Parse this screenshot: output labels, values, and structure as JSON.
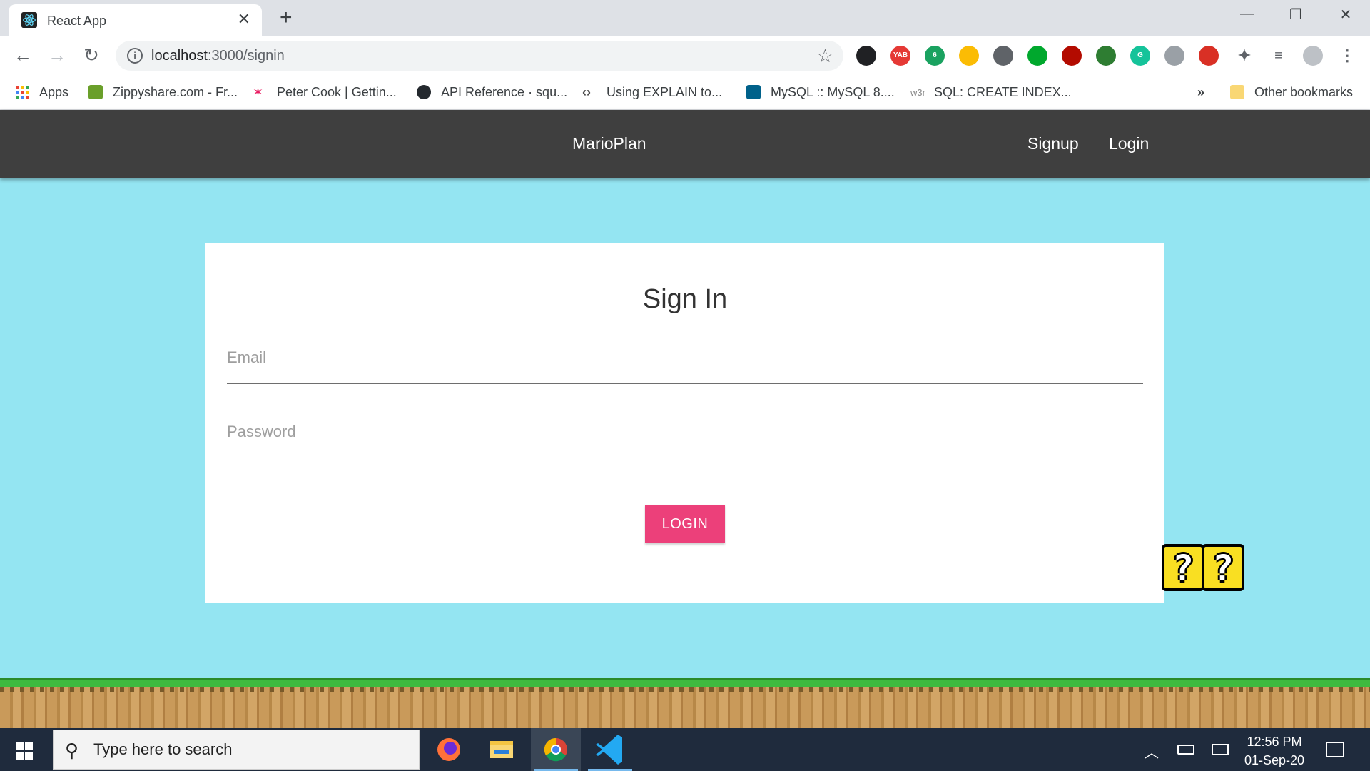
{
  "browser": {
    "tab_title": "React App",
    "tab_close": "✕",
    "new_tab": "+",
    "window_controls": {
      "minimize": "—",
      "restore": "❐",
      "close": "✕"
    },
    "nav": {
      "back": "←",
      "forward": "→",
      "reload": "↻"
    },
    "url_host": "localhost",
    "url_path": ":3000/signin",
    "info_icon": "i",
    "star_icon": "☆",
    "extensions": [
      {
        "name": "Tab Manager",
        "color": "#202124",
        "text": ""
      },
      {
        "name": "YAB",
        "color": "#e53935",
        "text": "YAB"
      },
      {
        "name": "Badge Extension",
        "color": "#1aa260",
        "text": "6"
      },
      {
        "name": "Heart",
        "color": "#fbbc04",
        "text": ""
      },
      {
        "name": "Pocket",
        "color": "#5f6368",
        "text": ""
      },
      {
        "name": "Evernote",
        "color": "#00a82d",
        "text": ""
      },
      {
        "name": "Acrobat",
        "color": "#b30b00",
        "text": ""
      },
      {
        "name": "Globe",
        "color": "#2e7d32",
        "text": ""
      },
      {
        "name": "Grammarly",
        "color": "#15c39a",
        "text": "G"
      },
      {
        "name": "Mouse",
        "color": "#9aa0a6",
        "text": ""
      },
      {
        "name": "Dots",
        "color": "#d93025",
        "text": ""
      }
    ],
    "bookmarks": [
      {
        "label": "Apps"
      },
      {
        "label": "Zippyshare.com - Fr...",
        "color": "#6a9f2a"
      },
      {
        "label": "Peter Cook | Gettin...",
        "color": "#e91e63"
      },
      {
        "label": "API Reference · squ...",
        "color": "#24292e"
      },
      {
        "label": "Using EXPLAIN to...",
        "color": "#444444"
      },
      {
        "label": "MySQL :: MySQL 8....",
        "color": "#00618a"
      },
      {
        "label": "SQL: CREATE INDEX...",
        "color": "#888888",
        "prefix": "w3r"
      }
    ],
    "bookmarks_overflow": "»",
    "other_bookmarks": "Other bookmarks"
  },
  "app": {
    "brand": "MarioPlan",
    "nav_links": [
      "Signup",
      "Login"
    ]
  },
  "signin": {
    "title": "Sign In",
    "email_label": "Email",
    "password_label": "Password",
    "login_button": "LOGIN"
  },
  "decor": {
    "question_block": "?"
  },
  "taskbar": {
    "search_placeholder": "Type here to search",
    "search_icon": "⚲",
    "apps": [
      "Firefox",
      "File Explorer",
      "Chrome",
      "Visual Studio Code"
    ],
    "time": "12:56 PM",
    "date": "01-Sep-20",
    "tray_chevron": "︿"
  }
}
